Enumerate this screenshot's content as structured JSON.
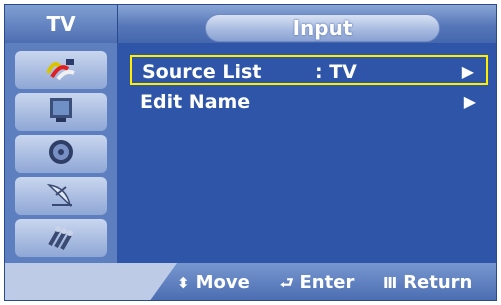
{
  "header": {
    "mode_label": "TV",
    "title": "Input"
  },
  "sidebar": {
    "items": [
      {
        "icon": "av-plug-icon"
      },
      {
        "icon": "picture-icon"
      },
      {
        "icon": "sound-speaker-icon"
      },
      {
        "icon": "satellite-dish-icon"
      },
      {
        "icon": "cable-connector-icon"
      }
    ]
  },
  "menu": {
    "items": [
      {
        "label": "Source List",
        "value": ":  TV",
        "arrow": "▶",
        "selected": true
      },
      {
        "label": "Edit Name",
        "value": "",
        "arrow": "▶",
        "selected": false
      }
    ]
  },
  "footer": {
    "move": {
      "glyph": "⬍",
      "label": "Move"
    },
    "enter": {
      "glyph": "⮐",
      "label": "Enter"
    },
    "return": {
      "glyph": "Ⅲ",
      "label": "Return"
    }
  },
  "colors": {
    "background": "#2e55a8",
    "selection": "#ffee00",
    "text": "#ffffff"
  }
}
